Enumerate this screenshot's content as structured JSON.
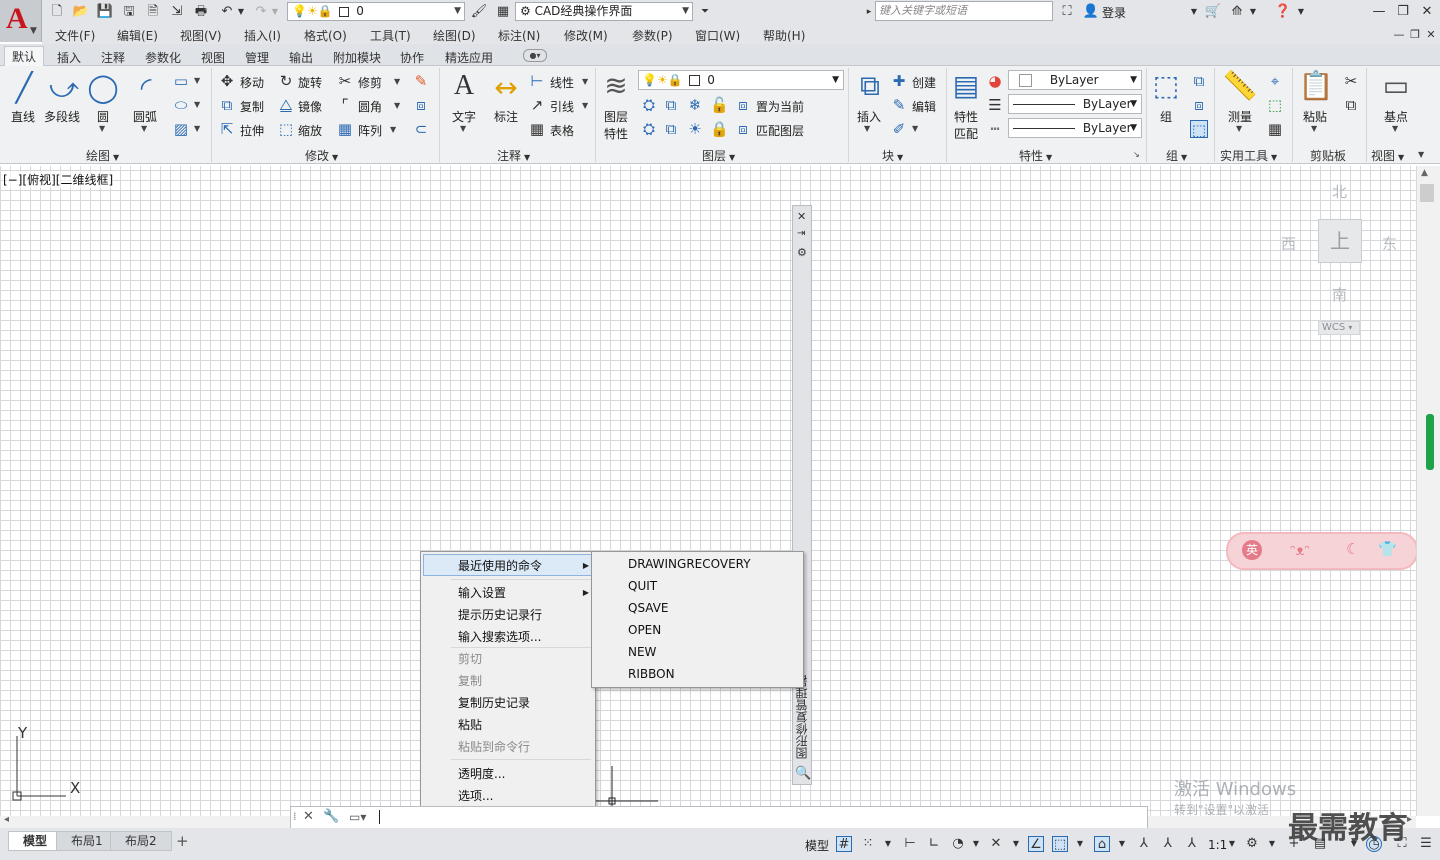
{
  "titlebar": {
    "app_logo": "A",
    "layer_value": "0",
    "workspace": "CAD经典操作界面",
    "search_placeholder": "键入关键字或短语",
    "login": "登录"
  },
  "menubar": [
    "文件(F)",
    "编辑(E)",
    "视图(V)",
    "插入(I)",
    "格式(O)",
    "工具(T)",
    "绘图(D)",
    "标注(N)",
    "修改(M)",
    "参数(P)",
    "窗口(W)",
    "帮助(H)"
  ],
  "ribbon_tabs": [
    "默认",
    "插入",
    "注释",
    "参数化",
    "视图",
    "管理",
    "输出",
    "附加模块",
    "协作",
    "精选应用"
  ],
  "ribbon": {
    "draw": {
      "line": "直线",
      "polyline": "多段线",
      "circle": "圆",
      "arc": "圆弧",
      "label": "绘图"
    },
    "modify": {
      "move": "移动",
      "rotate": "旋转",
      "trim": "修剪",
      "copy": "复制",
      "mirror": "镜像",
      "fillet": "圆角",
      "stretch": "拉伸",
      "scale": "缩放",
      "array": "阵列",
      "label": "修改"
    },
    "annotation": {
      "text": "文字",
      "dimension": "标注",
      "linear": "线性",
      "leader": "引线",
      "table": "表格",
      "label": "注释"
    },
    "layers": {
      "layer_props_1": "图层",
      "layer_props_2": "特性",
      "layer_value": "0",
      "set_current": "置为当前",
      "match_layer": "匹配图层",
      "label": "图层"
    },
    "block": {
      "insert": "插入",
      "create": "创建",
      "edit": "编辑",
      "label": "块"
    },
    "properties": {
      "match_1": "特性",
      "match_2": "匹配",
      "color": "ByLayer",
      "linetype": "ByLayer",
      "lineweight": "ByLayer",
      "label": "特性"
    },
    "groups": {
      "group": "组",
      "label": "组"
    },
    "utilities": {
      "measure": "测量",
      "label": "实用工具"
    },
    "clipboard": {
      "paste": "粘贴",
      "label": "剪贴板"
    },
    "view": {
      "base": "基点",
      "label": "视图"
    }
  },
  "viewport_label": "[−][俯视][二维线框]",
  "viewcube": {
    "north": "北",
    "south": "南",
    "east": "东",
    "west": "西",
    "top": "上",
    "wcs": "WCS"
  },
  "ucs": {
    "x": "X",
    "y": "Y"
  },
  "palette_title": "图形修复管理器",
  "context_menu": {
    "items": [
      {
        "label": "最近使用的命令",
        "submenu": true,
        "enabled": true
      },
      {
        "label": "输入设置",
        "submenu": true,
        "enabled": true
      },
      {
        "label": "提示历史记录行",
        "enabled": true
      },
      {
        "label": "输入搜索选项...",
        "enabled": true
      },
      {
        "label": "剪切",
        "enabled": false
      },
      {
        "label": "复制",
        "enabled": false
      },
      {
        "label": "复制历史记录",
        "enabled": true
      },
      {
        "label": "粘贴",
        "enabled": true
      },
      {
        "label": "粘贴到命令行",
        "enabled": false
      },
      {
        "label": "透明度...",
        "enabled": true
      },
      {
        "label": "选项...",
        "enabled": true
      }
    ],
    "recent_commands": [
      "DRAWINGRECOVERY",
      "QUIT",
      "QSAVE",
      "OPEN",
      "NEW",
      "RIBBON"
    ]
  },
  "layout_tabs": [
    "模型",
    "布局1",
    "布局2",
    "+"
  ],
  "statusbar": {
    "model": "模型",
    "scale": "1:1"
  },
  "watermark": {
    "windows_1": "激活 Windows",
    "windows_2": "转到\"设置\"以激活",
    "brand": "最需教育"
  },
  "sticker_text": "英"
}
